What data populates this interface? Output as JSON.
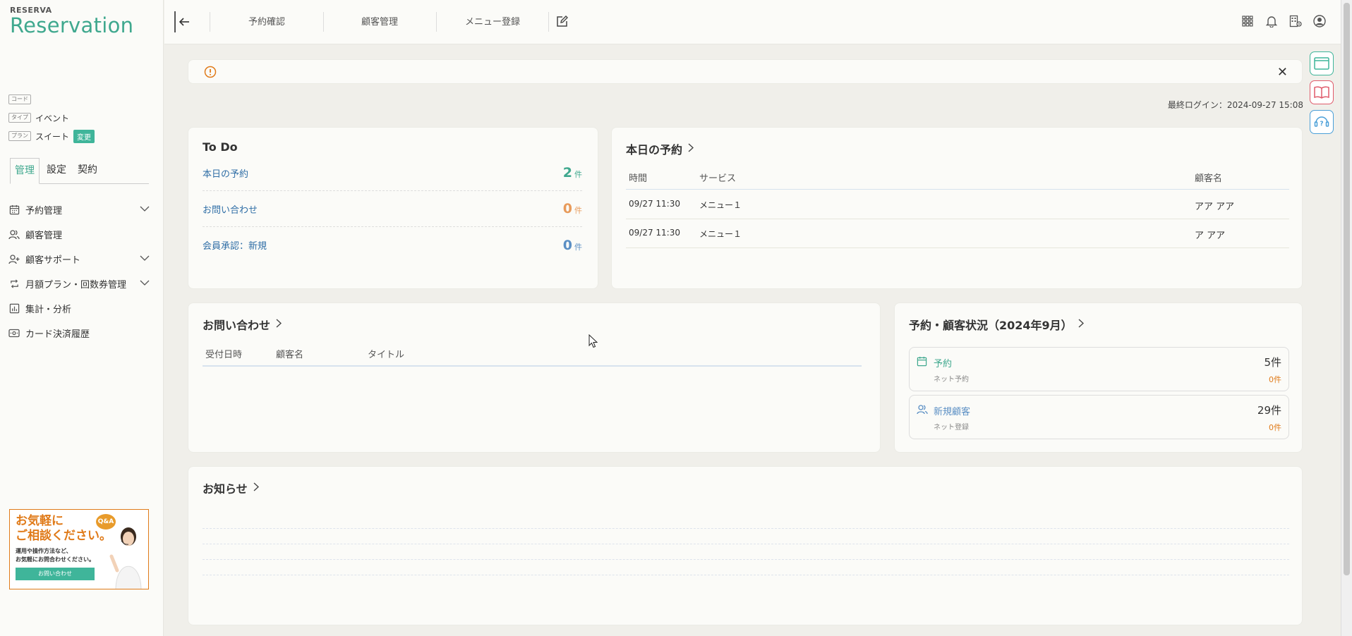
{
  "brand": {
    "small": "RESERVA",
    "big": "Reservation"
  },
  "meta": [
    {
      "tag": "コード",
      "value": ""
    },
    {
      "tag": "タイプ",
      "value": "イベント"
    },
    {
      "tag": "プラン",
      "value": "スイート",
      "action": "変更"
    }
  ],
  "tabs": [
    "管理",
    "設定",
    "契約"
  ],
  "menu": [
    {
      "label": "予約管理",
      "icon": "calendar-icon",
      "expandable": true
    },
    {
      "label": "顧客管理",
      "icon": "users-icon",
      "expandable": false
    },
    {
      "label": "顧客サポート",
      "icon": "user-plus-icon",
      "expandable": true
    },
    {
      "label": "月額プラン・回数券管理",
      "icon": "repeat-icon",
      "expandable": true
    },
    {
      "label": "集計・分析",
      "icon": "chart-icon",
      "expandable": false
    },
    {
      "label": "カード決済履歴",
      "icon": "card-icon",
      "expandable": false
    }
  ],
  "banner": {
    "title_line1": "お気軽に",
    "title_line2": "ご相談ください。",
    "sub_line1": "運用や操作方法など、",
    "sub_line2": "お気軽にお問合わせください。",
    "button": "お問い合わせ",
    "qa": "Q&A"
  },
  "topnav": [
    "予約確認",
    "顧客管理",
    "メニュー登録"
  ],
  "last_login": "最終ログイン：2024-09-27 15:08",
  "todo": {
    "title": "To Do",
    "items": [
      {
        "label": "本日の予約",
        "count": "2",
        "unit": "件",
        "color": "#3fa88e"
      },
      {
        "label": "お問い合わせ",
        "count": "0",
        "unit": "件",
        "color": "#e89b5b"
      },
      {
        "label": "会員承認：新規",
        "count": "0",
        "unit": "件",
        "color": "#5b8fc4"
      }
    ]
  },
  "today": {
    "title": "本日の予約",
    "headers": [
      "時間",
      "サービス",
      "顧客名"
    ],
    "rows": [
      {
        "time": "09/27 11:30",
        "service": "メニュー１",
        "customer": "アア アア"
      },
      {
        "time": "09/27 11:30",
        "service": "メニュー１",
        "customer": "ア アア"
      }
    ]
  },
  "inquiry": {
    "title": "お問い合わせ",
    "headers": [
      "受付日時",
      "顧客名",
      "タイトル"
    ]
  },
  "status": {
    "title": "予約・顧客状況（2024年9月）",
    "items": [
      {
        "label": "予約",
        "sub": "ネット予約",
        "value": "5件",
        "sub_value": "0件",
        "color": "#3fa88e"
      },
      {
        "label": "新規顧客",
        "sub": "ネット登録",
        "value": "29件",
        "sub_value": "0件",
        "color": "#5b8fc4"
      }
    ]
  },
  "notice": {
    "title": "お知らせ"
  }
}
